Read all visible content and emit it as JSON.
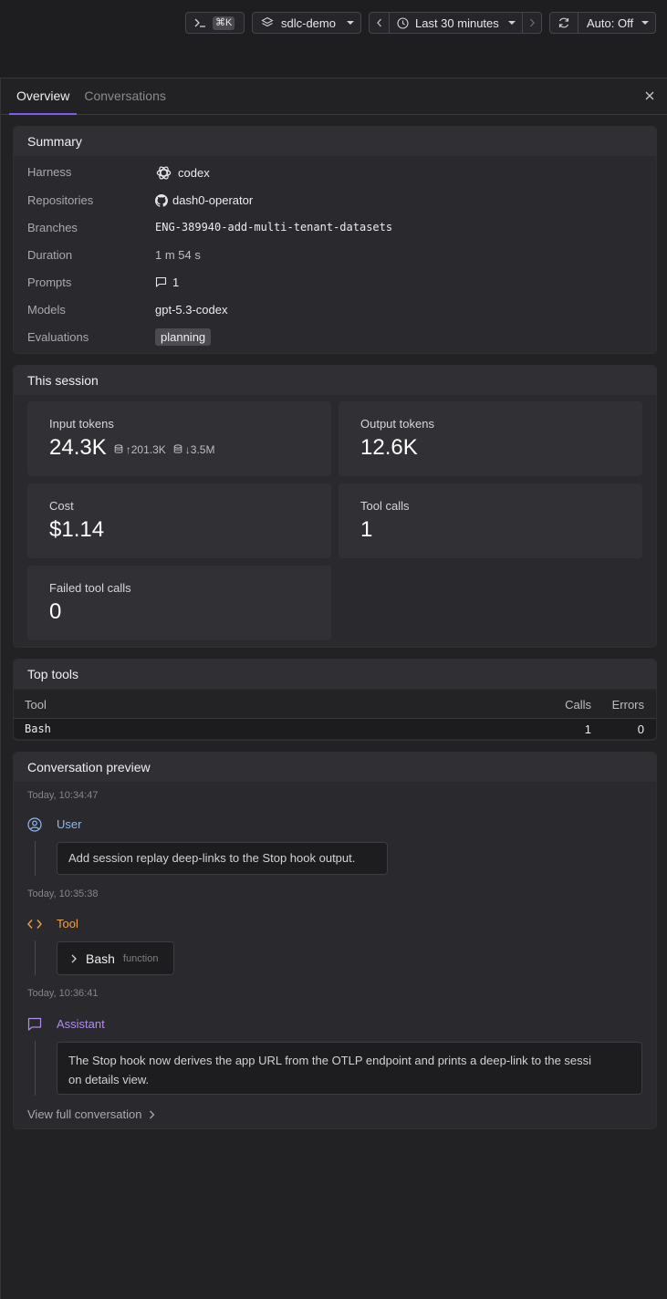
{
  "toolbar": {
    "shortcut_key": "⌘K",
    "dataset": "sdlc-demo",
    "time_range": "Last 30 minutes",
    "auto_refresh": "Auto: Off"
  },
  "tabs": [
    "Overview",
    "Conversations"
  ],
  "summary": {
    "title": "Summary",
    "rows": [
      {
        "label": "Harness",
        "value": "codex"
      },
      {
        "label": "Repositories",
        "value": "dash0-operator"
      },
      {
        "label": "Branches",
        "value": "ENG-389940-add-multi-tenant-datasets"
      },
      {
        "label": "Duration",
        "value": "1 m 54 s"
      },
      {
        "label": "Prompts",
        "value": "1"
      },
      {
        "label": "Models",
        "value": "gpt-5.3-codex"
      },
      {
        "label": "Evaluations",
        "value": "planning"
      }
    ]
  },
  "session": {
    "title": "This session",
    "input_tokens": {
      "label": "Input tokens",
      "value": "24.3K",
      "cache_write": "↑201.3K",
      "cache_read": "↓3.5M"
    },
    "output_tokens": {
      "label": "Output tokens",
      "value": "12.6K"
    },
    "cost": {
      "label": "Cost",
      "value": "$1.14"
    },
    "tool_calls": {
      "label": "Tool calls",
      "value": "1"
    },
    "failed_tool_calls": {
      "label": "Failed tool calls",
      "value": "0"
    }
  },
  "top_tools": {
    "title": "Top tools",
    "columns": [
      "Tool",
      "Calls",
      "Errors"
    ],
    "rows": [
      {
        "tool": "Bash",
        "calls": "1",
        "errors": "0"
      }
    ]
  },
  "conversation": {
    "title": "Conversation preview",
    "entries": [
      {
        "time": "Today, 10:34:47",
        "role": "User",
        "text": "Add session replay deep-links to the Stop hook output."
      },
      {
        "time": "Today, 10:35:38",
        "role": "Tool",
        "tool_name": "Bash",
        "tool_kind": "function"
      },
      {
        "time": "Today, 10:36:41",
        "role": "Assistant",
        "text_line1": "The Stop hook now derives the app URL from the OTLP endpoint and prints a deep-link to the sessi",
        "text_line2": "on details view."
      }
    ],
    "view_full": "View full conversation"
  },
  "colors": {
    "accent": "#7c5cf0",
    "user": "#8fb7f0",
    "tool": "#f0a040",
    "assistant": "#b08cf0"
  }
}
